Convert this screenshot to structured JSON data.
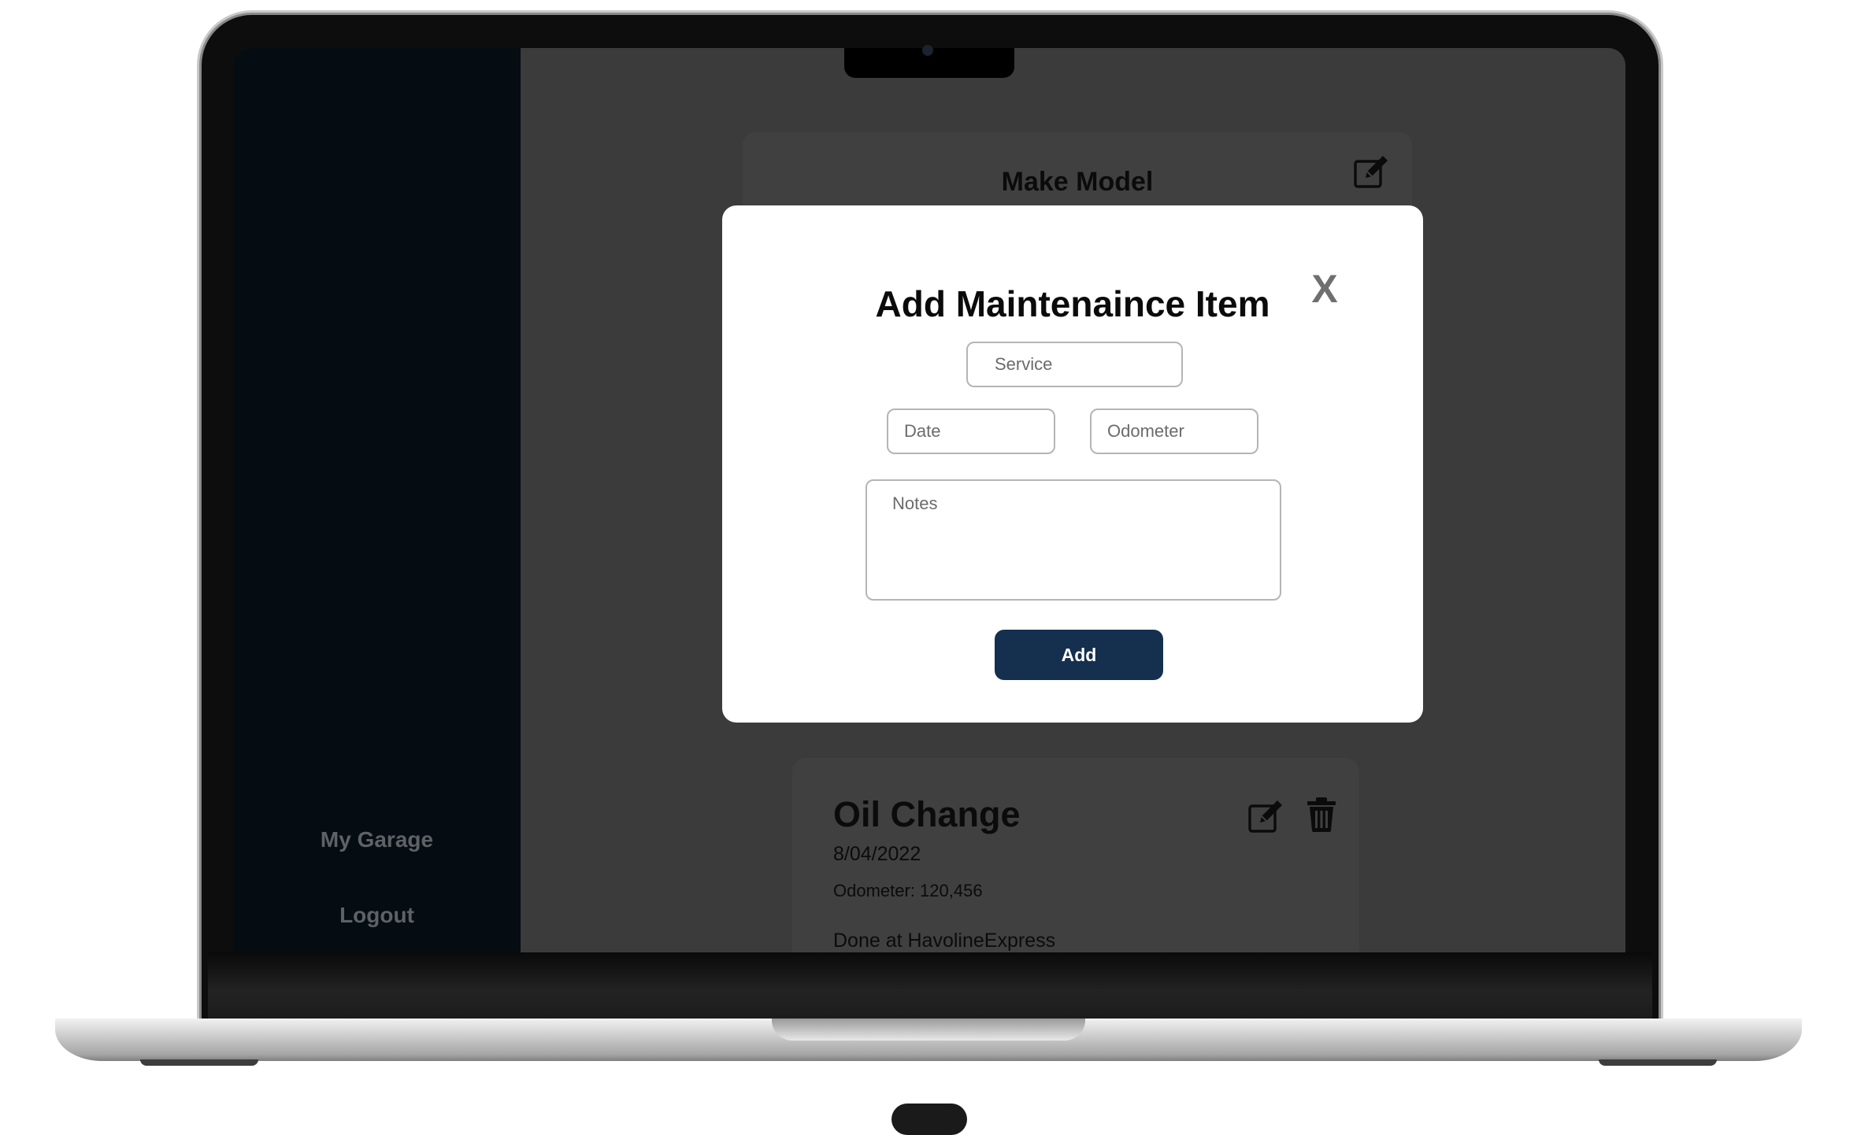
{
  "sidebar": {
    "items": [
      {
        "label": "My Garage"
      },
      {
        "label": "Logout"
      }
    ]
  },
  "vehicle": {
    "title": "Make Model",
    "edit_icon": "edit-icon"
  },
  "modal": {
    "title": "Add Maintenaince Item",
    "close_label": "X",
    "service_placeholder": "Service",
    "date_placeholder": "Date",
    "odometer_placeholder": "Odometer",
    "notes_placeholder": "Notes",
    "add_label": "Add"
  },
  "maintenance_items": [
    {
      "title": "Oil Change",
      "date": "8/04/2022",
      "odometer": "Odometer: 120,456",
      "notes": "Done at HavolineExpress"
    }
  ],
  "colors": {
    "sidebar_bg": "#050c12",
    "content_bg": "#3b3b3b",
    "card_bg": "#404040",
    "modal_bg": "#ffffff",
    "primary_button": "#152f4e",
    "nav_text": "#5e6266",
    "close_x": "#6f6f6f"
  }
}
